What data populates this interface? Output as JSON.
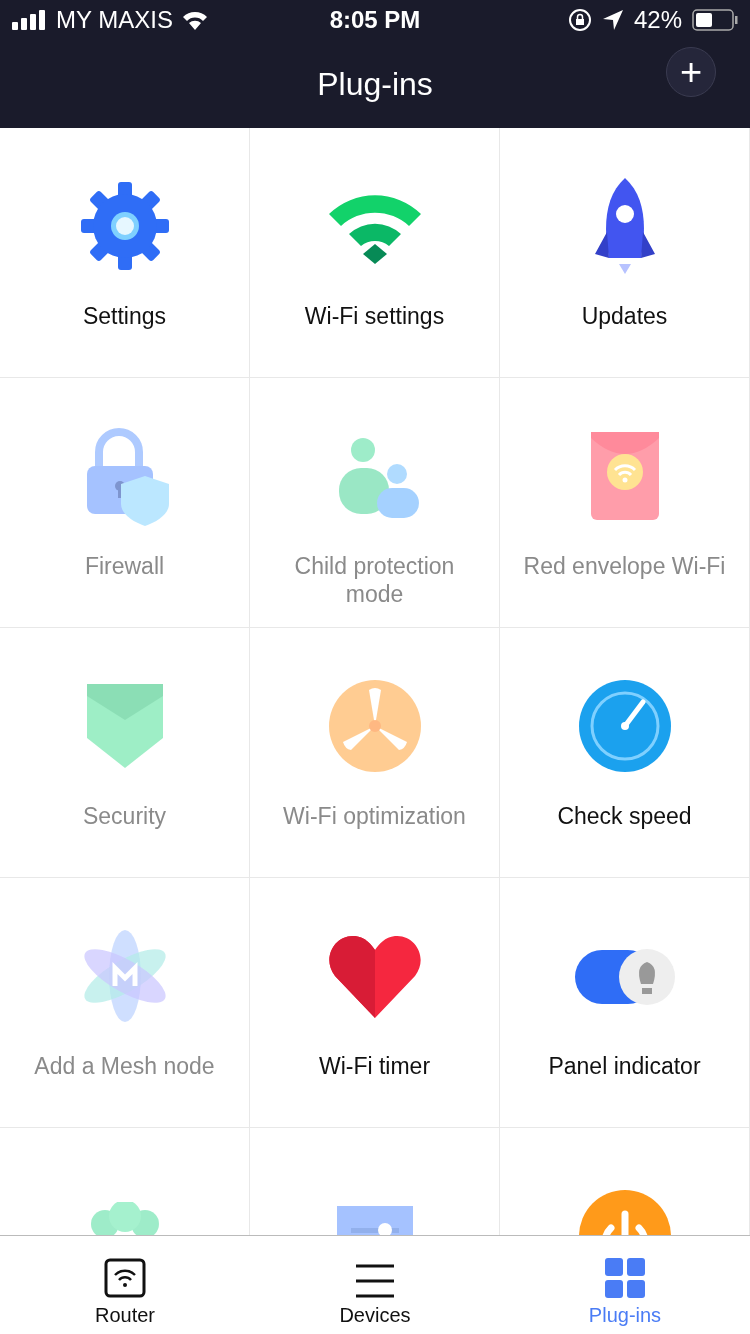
{
  "status_bar": {
    "carrier": "MY MAXIS",
    "time": "8:05 PM",
    "battery": "42%"
  },
  "header": {
    "title": "Plug-ins",
    "add_button": "+"
  },
  "plugins": [
    {
      "kind": "gear",
      "label": "Settings",
      "disabled": false
    },
    {
      "kind": "wifi",
      "label": "Wi-Fi settings",
      "disabled": false
    },
    {
      "kind": "rocket",
      "label": "Updates",
      "disabled": false
    },
    {
      "kind": "lock",
      "label": "Firewall",
      "disabled": true
    },
    {
      "kind": "people",
      "label": "Child protection mode",
      "disabled": true
    },
    {
      "kind": "envelope",
      "label": "Red envelope Wi-Fi",
      "disabled": true
    },
    {
      "kind": "shield",
      "label": "Security",
      "disabled": true
    },
    {
      "kind": "fan",
      "label": "Wi-Fi optimization",
      "disabled": true
    },
    {
      "kind": "gauge",
      "label": "Check speed",
      "disabled": false
    },
    {
      "kind": "mesh",
      "label": "Add a Mesh node",
      "disabled": true
    },
    {
      "kind": "heart",
      "label": "Wi-Fi timer",
      "disabled": false
    },
    {
      "kind": "toggle",
      "label": "Panel indicator",
      "disabled": false
    },
    {
      "kind": "group",
      "disabled": true
    },
    {
      "kind": "slider",
      "disabled": true
    },
    {
      "kind": "power",
      "disabled": false
    }
  ],
  "tab_bar": [
    {
      "kind": "router",
      "label": "Router",
      "selected": false
    },
    {
      "kind": "devices",
      "label": "Devices",
      "selected": false
    },
    {
      "kind": "plugins",
      "label": "Plug-ins",
      "selected": true
    }
  ]
}
